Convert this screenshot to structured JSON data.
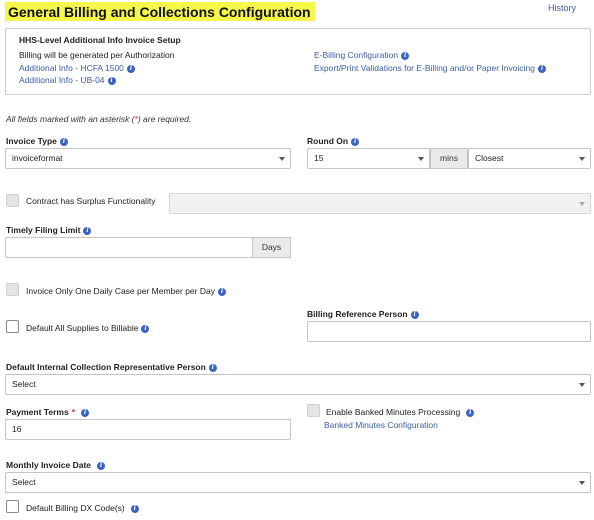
{
  "page": {
    "title": "General Billing and Collections Configuration",
    "history_link": "History"
  },
  "setup": {
    "heading": "HHS-Level Additional Info Invoice Setup",
    "billing_text": "Billing will be generated per Authorization",
    "link_hcfa": "Additional Info - HCFA 1500",
    "link_ub04": "Additional Info - UB-04",
    "link_ebilling": "E-Billing Configuration",
    "link_export": "Export/Print Validations for E-Billing and/or Paper Invoicing"
  },
  "required_note": {
    "before": "All fields marked with an asterisk (",
    "asterisk": "*",
    "after": ") are required."
  },
  "invoice_type": {
    "label": "Invoice Type",
    "value": "invoiceformat"
  },
  "round_on": {
    "label": "Round On",
    "value": "15",
    "unit": "mins",
    "mode": "Closest"
  },
  "surplus": {
    "label": "Contract has Surplus Functionality",
    "checked": false,
    "value": ""
  },
  "timely_filing": {
    "label": "Timely Filing Limit",
    "value": "",
    "unit": "Days"
  },
  "daily_case": {
    "label": "Invoice Only One Daily Case per Member per Day",
    "checked": false
  },
  "supplies_billable": {
    "label": "Default All Supplies to Billable",
    "checked": false
  },
  "billing_reference": {
    "label": "Billing Reference Person",
    "value": ""
  },
  "collection_rep": {
    "label": "Default Internal Collection Representative Person",
    "value": "Select"
  },
  "payment_terms": {
    "label": "Payment Terms",
    "required": "*",
    "value": "16"
  },
  "banked_minutes": {
    "label": "Enable Banked Minutes Processing",
    "checked": false,
    "link": "Banked Minutes Configuration"
  },
  "monthly_invoice_date": {
    "label": "Monthly Invoice Date",
    "value": "Select"
  },
  "billing_dx": {
    "label": "Default Billing DX Code(s)",
    "checked": false
  },
  "icons": {
    "info": "info-icon",
    "dropdown": "chevron-down-icon"
  },
  "colors": {
    "title_highlight": "#f5f74a",
    "link": "#3a5ea8",
    "info_icon": "#3b63c4",
    "required": "#d33333"
  }
}
